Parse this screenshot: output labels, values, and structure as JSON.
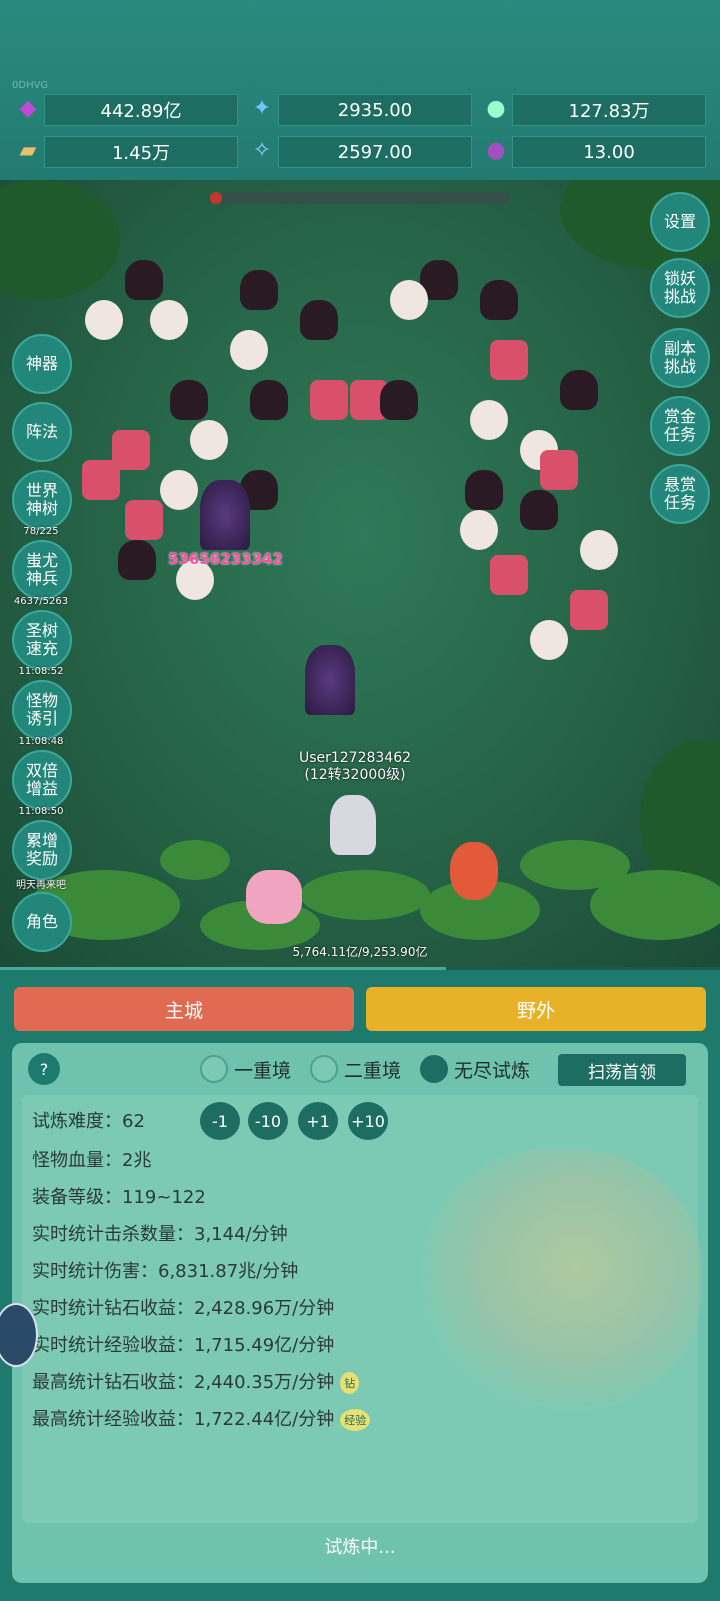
{
  "top": {
    "tag": "0DHVG",
    "resources": [
      {
        "icon": "gem-icon",
        "value": "442.89亿"
      },
      {
        "icon": "crystal-icon",
        "value": "2935.00"
      },
      {
        "icon": "orb-icon",
        "value": "127.83万"
      },
      {
        "icon": "scroll-icon",
        "value": "1.45万"
      },
      {
        "icon": "shard-icon",
        "value": "2597.00"
      },
      {
        "icon": "pot-icon",
        "value": "13.00"
      }
    ]
  },
  "left_menu": [
    {
      "label": "神器",
      "timer": ""
    },
    {
      "label": "阵法",
      "timer": ""
    },
    {
      "label": "世界神树",
      "timer": "78/225"
    },
    {
      "label": "蚩尤神兵",
      "timer": "4637/5263"
    },
    {
      "label": "圣树速充",
      "timer": "11:08:52"
    },
    {
      "label": "怪物诱引",
      "timer": "11:08:48"
    },
    {
      "label": "双倍增益",
      "timer": "11:08:50"
    },
    {
      "label": "累增奖励",
      "timer": "明天再来吧"
    },
    {
      "label": "角色",
      "timer": ""
    }
  ],
  "right_menu": [
    "设置",
    "锁妖挑战",
    "副本挑战",
    "赏金任务",
    "悬赏任务"
  ],
  "battle": {
    "damage": "53656233342",
    "player_name": "User127283462",
    "player_level": "(12转32000级)",
    "hp_text": "5,764.11亿/9,253.90亿",
    "hp_fraction": 0.62,
    "wave_fraction": 0.04
  },
  "tabs": {
    "city": "主城",
    "wild": "野外"
  },
  "panel": {
    "help": "?",
    "modes": [
      {
        "label": "一重境",
        "selected": false
      },
      {
        "label": "二重境",
        "selected": false
      },
      {
        "label": "无尽试炼",
        "selected": true
      }
    ],
    "sweep": "扫荡首领",
    "difficulty": "试炼难度：62",
    "adjust": [
      "-1",
      "-10",
      "+1",
      "+10"
    ],
    "rows": [
      "怪物血量：2兆",
      "装备等级：119~122",
      "实时统计击杀数量：3,144/分钟",
      "实时统计伤害：6,831.87兆/分钟",
      "实时统计钻石收益：2,428.96万/分钟",
      "实时统计经验收益：1,715.49亿/分钟",
      "最高统计钻石收益：2,440.35万/分钟",
      "最高统计经验收益：1,722.44亿/分钟"
    ],
    "badge_diamond": "钻",
    "badge_exp": "经验",
    "status": "试炼中..."
  },
  "colors": {
    "city_tab": "#e06a52",
    "wild_tab": "#e8b228",
    "accent": "#1d6d63"
  }
}
